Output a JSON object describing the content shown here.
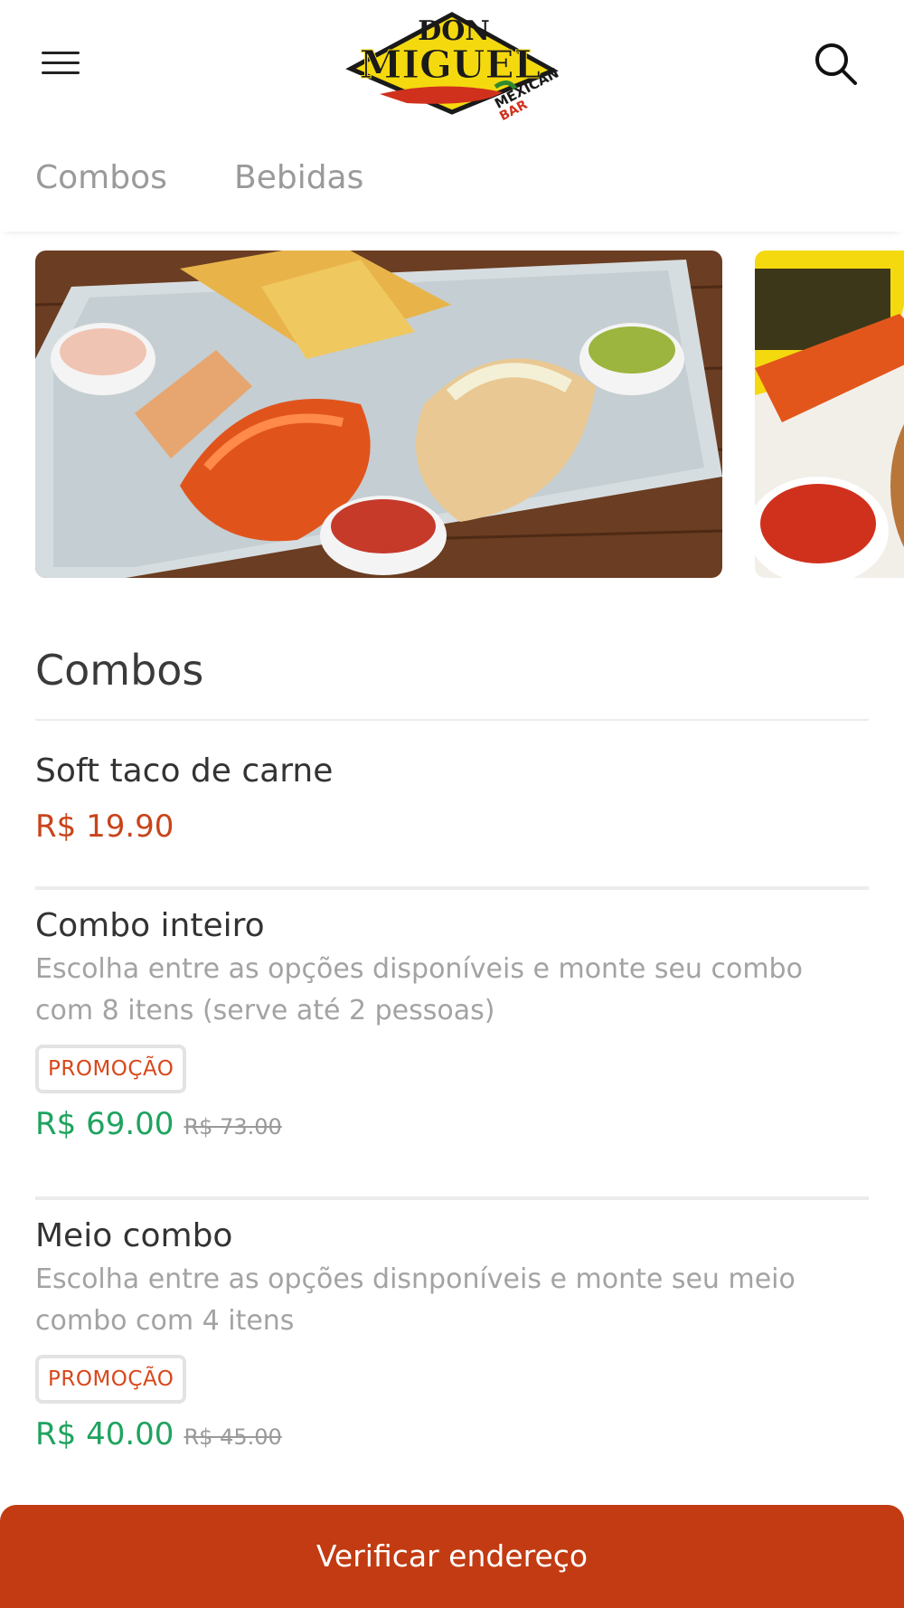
{
  "header": {
    "logo": {
      "line1": "DON",
      "line2": "MIGUEL",
      "line3": "MEXICAN",
      "line4": "BAR"
    },
    "menu_icon": "hamburger-menu-icon",
    "search_icon": "search-icon"
  },
  "tabs": [
    {
      "label": "Combos"
    },
    {
      "label": "Bebidas"
    }
  ],
  "section": {
    "title": "Combos"
  },
  "products": [
    {
      "name": "Soft taco de carne",
      "price": "R$ 19.90"
    },
    {
      "name": "Combo inteiro",
      "description": "Escolha entre as opções disponíveis e monte seu combo com 8 itens (serve até 2 pessoas)",
      "badge": "PROMOÇÃO",
      "price": "R$ 69.00",
      "old_price": "R$ 73.00"
    },
    {
      "name": "Meio combo",
      "description": "Escolha entre as opções disnponíveis e monte seu meio combo com 4 itens",
      "badge": "PROMOÇÃO",
      "price": "R$ 40.00",
      "old_price": "R$ 45.00"
    }
  ],
  "cta": {
    "label": "Verificar endereço"
  },
  "colors": {
    "brand": "#c23b12",
    "price_red": "#c9441b",
    "price_green": "#1fa35f",
    "badge_text": "#d8471b"
  }
}
